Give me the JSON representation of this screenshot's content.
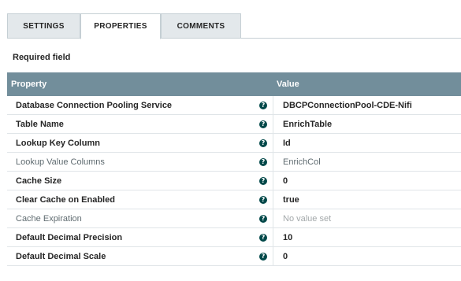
{
  "tabs": [
    {
      "label": "SETTINGS",
      "active": false
    },
    {
      "label": "PROPERTIES",
      "active": true
    },
    {
      "label": "COMMENTS",
      "active": false
    }
  ],
  "required_label": "Required field",
  "table": {
    "headers": {
      "property": "Property",
      "value": "Value"
    },
    "rows": [
      {
        "name": "Database Connection Pooling Service",
        "required": true,
        "value": "DBCPConnectionPool-CDE-Nifi",
        "value_style": "bold"
      },
      {
        "name": "Table Name",
        "required": true,
        "value": "EnrichTable",
        "value_style": "bold"
      },
      {
        "name": "Lookup Key Column",
        "required": true,
        "value": "Id",
        "value_style": "bold"
      },
      {
        "name": "Lookup Value Columns",
        "required": false,
        "value": "EnrichCol",
        "value_style": "plain"
      },
      {
        "name": "Cache Size",
        "required": true,
        "value": "0",
        "value_style": "bold"
      },
      {
        "name": "Clear Cache on Enabled",
        "required": true,
        "value": "true",
        "value_style": "bold"
      },
      {
        "name": "Cache Expiration",
        "required": false,
        "value": "No value set",
        "value_style": "empty"
      },
      {
        "name": "Default Decimal Precision",
        "required": true,
        "value": "10",
        "value_style": "bold"
      },
      {
        "name": "Default Decimal Scale",
        "required": true,
        "value": "0",
        "value_style": "bold"
      }
    ]
  },
  "colors": {
    "header_bg": "#728e9b",
    "tab_bg": "#e3e8eb",
    "help_icon": "#004849"
  },
  "icons": {
    "help": "question-circle-icon"
  }
}
